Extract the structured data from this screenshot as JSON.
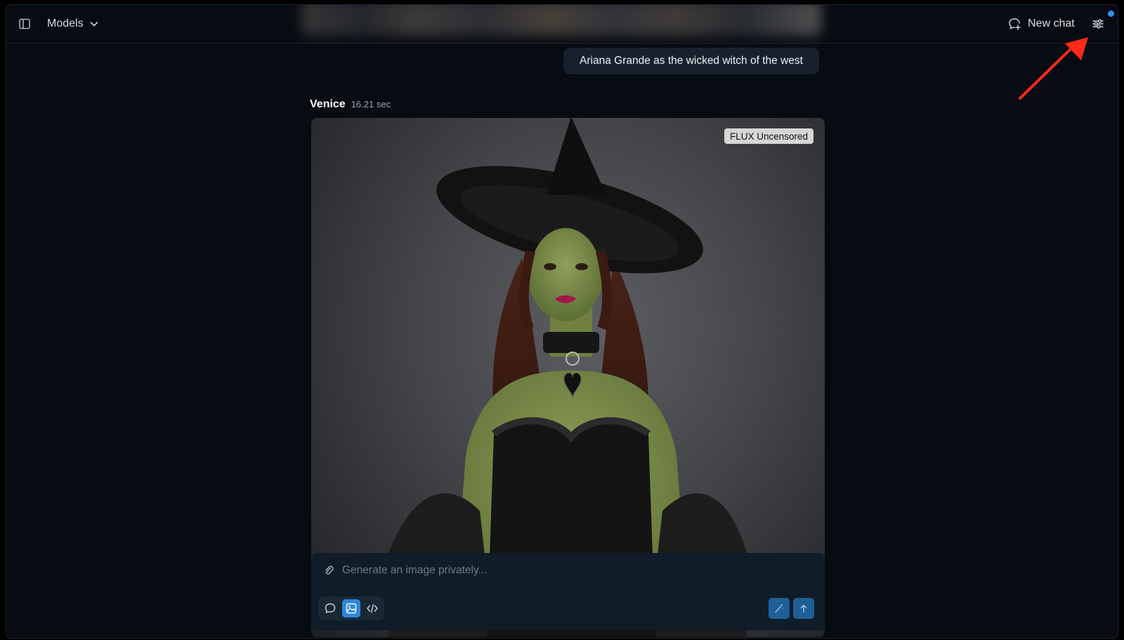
{
  "header": {
    "models_label": "Models",
    "new_chat_label": "New chat"
  },
  "conversation": {
    "user_message": "Ariana Grande as the wicked witch of the west",
    "assistant": {
      "name": "Venice",
      "time": "16.21 sec",
      "model_badge": "FLUX Uncensored"
    }
  },
  "composer": {
    "placeholder": "Generate an image privately...",
    "active_mode": "image"
  },
  "icons": [
    "sidebar-icon",
    "chevron-down-icon",
    "new-chat-icon",
    "settings-sliders-icon",
    "paperclip-icon",
    "chat-bubble-icon",
    "image-icon",
    "code-icon",
    "magic-wand-icon",
    "arrow-up-icon"
  ],
  "colors": {
    "background": "#070b12",
    "accent": "#2b86d9",
    "notification_dot": "#2f8ff0",
    "annotation_arrow": "#ff2a1a"
  }
}
